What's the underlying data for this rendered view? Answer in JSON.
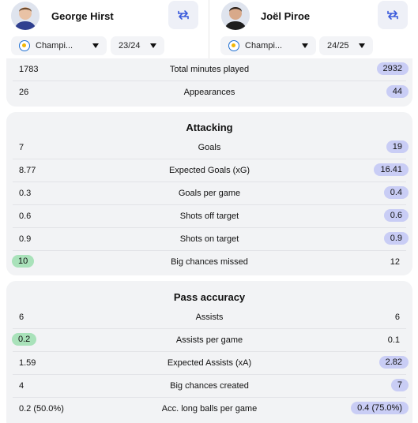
{
  "players": [
    {
      "name": "George Hirst",
      "competition": "Champi...",
      "season": "23/24"
    },
    {
      "name": "Joël Piroe",
      "competition": "Champi...",
      "season": "24/25"
    }
  ],
  "general": {
    "rows": [
      {
        "label": "Total minutes played",
        "left": "1783",
        "right": "2932",
        "highlight": "right"
      },
      {
        "label": "Appearances",
        "left": "26",
        "right": "44",
        "highlight": "right"
      }
    ]
  },
  "attacking": {
    "title": "Attacking",
    "rows": [
      {
        "label": "Goals",
        "left": "7",
        "right": "19",
        "highlight": "right"
      },
      {
        "label": "Expected Goals (xG)",
        "left": "8.77",
        "right": "16.41",
        "highlight": "right"
      },
      {
        "label": "Goals per game",
        "left": "0.3",
        "right": "0.4",
        "highlight": "right"
      },
      {
        "label": "Shots off target",
        "left": "0.6",
        "right": "0.6",
        "highlight": "right"
      },
      {
        "label": "Shots on target",
        "left": "0.9",
        "right": "0.9",
        "highlight": "right"
      },
      {
        "label": "Big chances missed",
        "left": "10",
        "right": "12",
        "highlight": "left"
      }
    ]
  },
  "pass_accuracy": {
    "title": "Pass accuracy",
    "rows": [
      {
        "label": "Assists",
        "left": "6",
        "right": "6",
        "highlight": "none"
      },
      {
        "label": "Assists per game",
        "left": "0.2",
        "right": "0.1",
        "highlight": "left"
      },
      {
        "label": "Expected Assists (xA)",
        "left": "1.59",
        "right": "2.82",
        "highlight": "right"
      },
      {
        "label": "Big chances created",
        "left": "4",
        "right": "7",
        "highlight": "right"
      },
      {
        "label": "Acc. long balls per game",
        "left": "0.2 (50.0%)",
        "right": "0.4 (75.0%)",
        "highlight": "right"
      }
    ]
  },
  "colors": {
    "highlight_better": "#c9cdf5",
    "highlight_lower_is_better": "#a9e2ba",
    "card_bg": "#f2f3f5",
    "swap_icon": "#3b5bdb"
  },
  "icons": {
    "swap": "swap-arrows-icon",
    "caret": "chevron-down-icon",
    "league": "league-logo-icon"
  }
}
